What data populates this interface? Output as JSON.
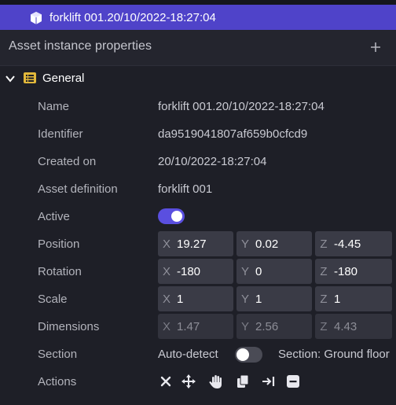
{
  "selected_item": {
    "label": "forklift 001.20/10/2022-18:27:04",
    "icon": "cube-icon"
  },
  "panel": {
    "title": "Asset instance properties",
    "add_icon": "plus-icon"
  },
  "section": {
    "label": "General",
    "expanded": true,
    "icon": "list-icon"
  },
  "properties": {
    "name": {
      "label": "Name",
      "value": "forklift 001.20/10/2022-18:27:04"
    },
    "identifier": {
      "label": "Identifier",
      "value": "da9519041807af659b0cfcd9"
    },
    "created_on": {
      "label": "Created on",
      "value": "20/10/2022-18:27:04"
    },
    "asset_definition": {
      "label": "Asset definition",
      "value": "forklift 001"
    },
    "active": {
      "label": "Active",
      "value": true
    },
    "position": {
      "label": "Position",
      "x": "19.27",
      "y": "0.02",
      "z": "-4.45"
    },
    "rotation": {
      "label": "Rotation",
      "x": "-180",
      "y": "0",
      "z": "-180"
    },
    "scale": {
      "label": "Scale",
      "x": "1",
      "y": "1",
      "z": "1"
    },
    "dimensions": {
      "label": "Dimensions",
      "x": "1.47",
      "y": "2.56",
      "z": "4.43"
    },
    "section": {
      "label": "Section",
      "auto_detect_label": "Auto-detect",
      "auto_detect": false,
      "section_text": "Section: Ground floor"
    },
    "actions": {
      "label": "Actions",
      "icons": [
        "close-icon",
        "move-icon",
        "hand-icon",
        "copy-icon",
        "align-right-icon",
        "minus-square-icon"
      ]
    }
  },
  "axes": {
    "x": "X",
    "y": "Y",
    "z": "Z"
  },
  "colors": {
    "accent": "#4f43c9",
    "toggle_on": "#5a4fe0",
    "background": "#1e1f27"
  }
}
